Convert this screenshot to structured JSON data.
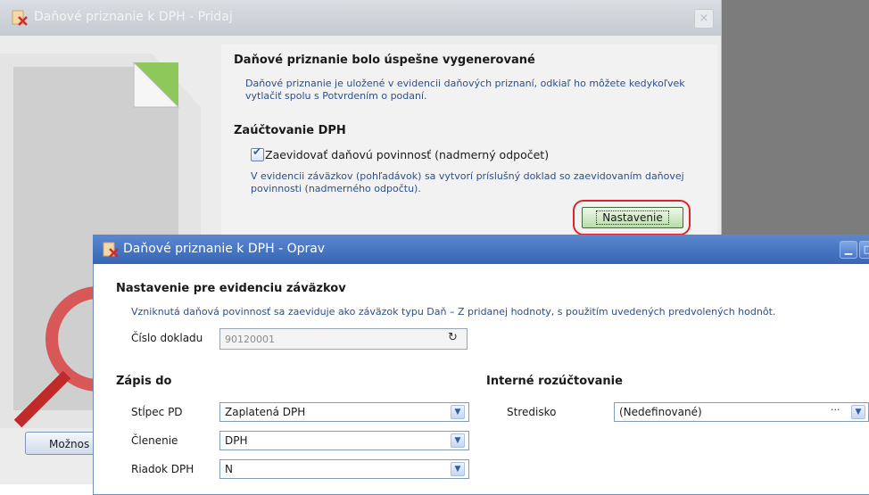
{
  "bg_dialog": {
    "title": "Daňové priznanie k DPH - Pridaj",
    "close_label": "×",
    "generated_title": "Daňové priznanie bolo úspešne vygenerované",
    "generated_text": "Daňové priznanie je uložené v evidencii daňových priznaní, odkiaľ ho môžete kedykoľvek vytlačiť spolu s Potvrdením o podaní.",
    "dph_title": "Zaúčtovanie DPH",
    "checkbox_checked": true,
    "checkbox_label": "Zaevidovať daňovú povinnosť (nadmerný odpočet)",
    "evidence_text": "V evidencii záväzkov (pohľadávok) sa vytvorí príslušný doklad so zaevidovaním daňovej povinnosti (nadmerného odpočtu).",
    "settings_button": "Nastavenie",
    "options_button": "Možnos"
  },
  "fg_dialog": {
    "title": "Daňové priznanie k DPH - Oprav",
    "heading": "Nastavenie pre evidenciu záväzkov",
    "note": "Vzniknutá daňová povinnosť sa zaeviduje ako záväzok typu Daň – Z pridanej hodnoty, s použitím uvedených predvolených hodnôt.",
    "doc_number_label": "Číslo dokladu",
    "doc_number_value": "90120001",
    "zapis_heading": "Zápis do",
    "rozuctovanie_heading": "Interné rozúčtovanie",
    "fields": {
      "stlpec": {
        "label": "Stĺpec PD",
        "value": "Zaplatená DPH"
      },
      "clenenie": {
        "label": "Členenie",
        "value": "DPH"
      },
      "riadok": {
        "label": "Riadok DPH",
        "value": "N"
      },
      "stredisko": {
        "label": "Stredisko",
        "value": "(Nedefinované)"
      }
    }
  },
  "colors": {
    "accent_red": "#d9262a",
    "titlebar_blue": "#3765b4",
    "note_blue": "#2b4f8a"
  },
  "icons": [
    "app-icon",
    "close-icon",
    "checkbox-icon",
    "refresh-icon",
    "dropdown-arrow-icon",
    "ellipsis-icon",
    "minimize-icon",
    "maximize-icon"
  ]
}
